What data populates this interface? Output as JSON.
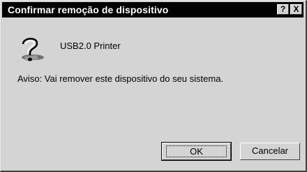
{
  "window": {
    "title": "Confirmar remoção de dispositivo",
    "help_label": "?",
    "close_label": "X"
  },
  "device": {
    "icon": "unknown-device-question-icon",
    "name": "USB2.0 Printer"
  },
  "warning_text": "Aviso: Vai remover este dispositivo do seu sistema.",
  "buttons": {
    "ok_label": "OK",
    "cancel_label": "Cancelar"
  },
  "colors": {
    "titlebar": "#000000",
    "face": "#d4d4d4"
  }
}
